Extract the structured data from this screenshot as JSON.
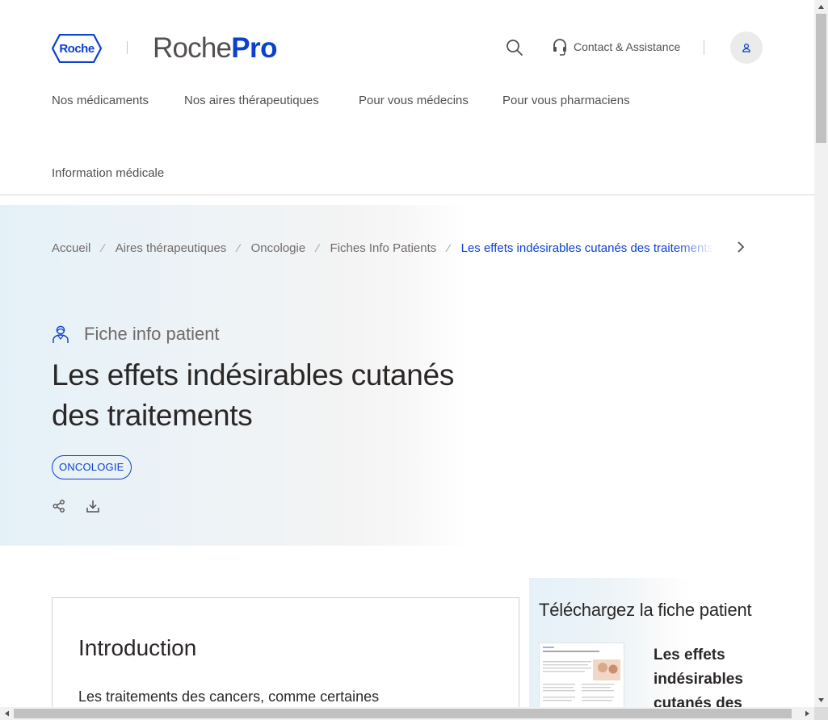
{
  "header": {
    "logo_text": "Roche",
    "brand_prefix": "Roche",
    "brand_suffix": "Pro",
    "contact_label": "Contact & Assistance"
  },
  "nav": {
    "items": [
      {
        "label": "Nos médicaments"
      },
      {
        "label": "Nos aires thérapeutiques"
      },
      {
        "label": "Pour vous médecins"
      },
      {
        "label": "Pour vous pharmaciens"
      },
      {
        "label": "Information médicale"
      }
    ]
  },
  "breadcrumb": {
    "items": [
      {
        "label": "Accueil"
      },
      {
        "label": "Aires thérapeutiques"
      },
      {
        "label": "Oncologie"
      },
      {
        "label": "Fiches Info Patients"
      }
    ],
    "current": "Les effets indésirables cutanés des traitements",
    "separator": "⁄"
  },
  "hero": {
    "kind": "Fiche info patient",
    "title": "Les effets indésirables cutanés des traitements",
    "tag": "ONCOLOGIE"
  },
  "intro": {
    "title": "Introduction",
    "text": "Les traitements des cancers, comme certaines"
  },
  "download": {
    "title": "Téléchargez la fiche patient",
    "doc_title": "Les effets indésirables cutanés des traitements"
  },
  "colors": {
    "accent": "#0b41cd",
    "text": "#544f4f",
    "heading": "#2b2727",
    "hero_start": "#e5f1f8"
  },
  "icons": [
    "roche-logo-icon",
    "search-icon",
    "headset-icon",
    "user-icon",
    "chevron-right-icon",
    "patient-icon",
    "share-icon",
    "download-icon"
  ]
}
